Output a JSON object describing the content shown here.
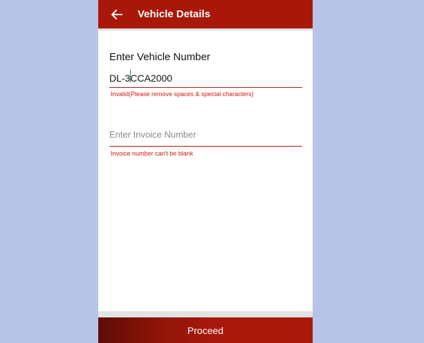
{
  "app_bar": {
    "back_icon": "arrow-left-icon",
    "title": "Vehicle Details",
    "color": "#a81708"
  },
  "vehicle": {
    "label": "Enter Vehicle Number",
    "value": "DL-3CCA2000",
    "error": "Invalid(Please remove spaces & special characters)"
  },
  "invoice": {
    "placeholder": "Enter Invoice Number",
    "value": "",
    "error": "Invoice number can't be blank"
  },
  "footer": {
    "proceed_label": "Proceed"
  },
  "colors": {
    "background": "#b7c4e8",
    "error": "#d21a0c",
    "primary": "#a81708"
  }
}
